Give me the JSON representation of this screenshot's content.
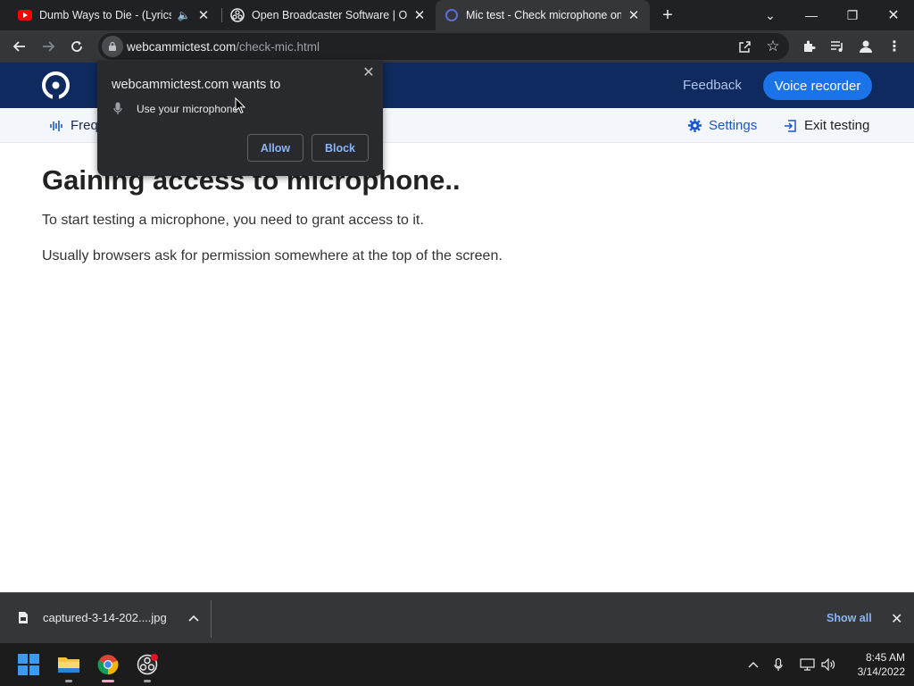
{
  "browser": {
    "tabs": [
      {
        "title": "Dumb Ways to Die - (Lyrics C",
        "favicon": "youtube-icon",
        "audio": true,
        "active": false
      },
      {
        "title": "Open Broadcaster Software | OBS",
        "favicon": "obs-icon",
        "active": false
      },
      {
        "title": "Mic test - Check microphone online",
        "favicon": "webcammictest-icon",
        "active": true
      }
    ],
    "url_host": "webcammictest.com",
    "url_path": "/check-mic.html"
  },
  "permission_prompt": {
    "title": "webcammictest.com wants to",
    "request": "Use your microphone",
    "allow_label": "Allow",
    "block_label": "Block"
  },
  "site": {
    "nav": {
      "feedback_label": "Feedback",
      "voice_recorder_label": "Voice recorder"
    },
    "subbar": {
      "frequency_label": "Freq",
      "settings_label": "Settings",
      "exit_label": "Exit testing"
    },
    "main": {
      "title": "Gaining access to microphone..",
      "paragraph1": "To start testing a microphone, you need to grant access to it.",
      "paragraph2": "Usually browsers ask for permission somewhere at the top of the screen."
    },
    "colors": {
      "header_bg": "#0f2a5f",
      "accent": "#1a73e8"
    }
  },
  "downloads": {
    "file_name": "captured-3-14-202....jpg",
    "show_all_label": "Show all"
  },
  "taskbar": {
    "time": "8:45 AM",
    "date": "3/14/2022"
  }
}
